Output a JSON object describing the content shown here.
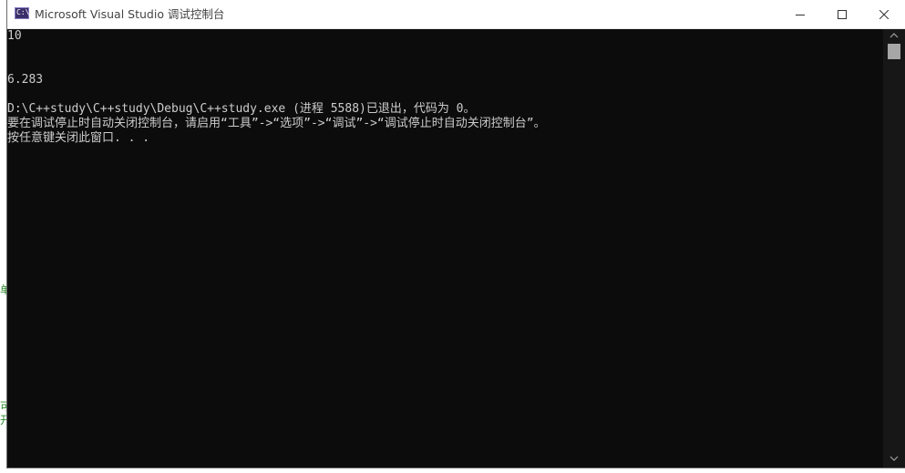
{
  "window": {
    "title": "Microsoft Visual Studio 调试控制台"
  },
  "console": {
    "lines": [
      "10",
      "",
      "",
      "6.283",
      "",
      "D:\\C++study\\C++study\\Debug\\C++study.exe (进程 5588)已退出，代码为 0。",
      "要在调试停止时自动关闭控制台，请启用“工具”->“选项”->“调试”->“调试停止时自动关闭控制台”。",
      "按任意键关闭此窗口. . ."
    ]
  },
  "background_glyphs": {
    "glyph_1": "单",
    "glyph_2": "可",
    "glyph_3": "开"
  },
  "icons": {
    "app": "console-app-icon",
    "minimize": "minimize-icon",
    "maximize": "maximize-icon",
    "close": "close-icon",
    "scroll_up": "chevron-up-icon",
    "scroll_down": "chevron-down-icon"
  },
  "colors": {
    "console_bg": "#0c0c0c",
    "console_text": "#cccccc",
    "titlebar_bg": "#ffffff",
    "background_glyph": "#2e8b2e"
  }
}
